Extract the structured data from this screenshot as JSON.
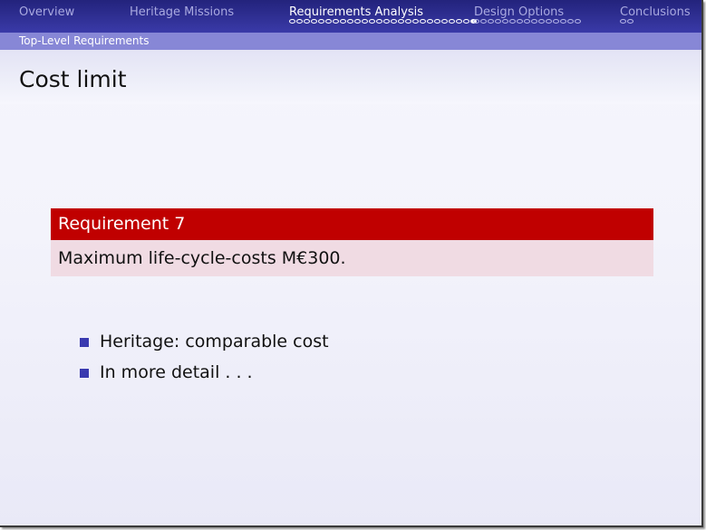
{
  "nav": {
    "sections": [
      {
        "label": "Overview",
        "active": false,
        "dots": 0
      },
      {
        "label": "Heritage Missions",
        "active": false,
        "dots": 0
      },
      {
        "label": "Requirements Analysis",
        "active": true,
        "dots": 26
      },
      {
        "label": "Design Options",
        "active": false,
        "dots": 15
      },
      {
        "label": "Conclusions",
        "active": false,
        "dots": 2
      }
    ]
  },
  "subsection": "Top-Level Requirements",
  "title": "Cost limit",
  "block": {
    "heading": "Requirement 7",
    "body": "Maximum life-cycle-costs M€300."
  },
  "bullets": [
    "Heritage: comparable cost",
    "In more detail . . ."
  ],
  "colors": {
    "nav_background": "#2b2b8f",
    "subbar_background": "#8787d6",
    "block_heading": "#c00000",
    "block_body": "#f0dbe3",
    "bullet": "#3a3ab0"
  }
}
